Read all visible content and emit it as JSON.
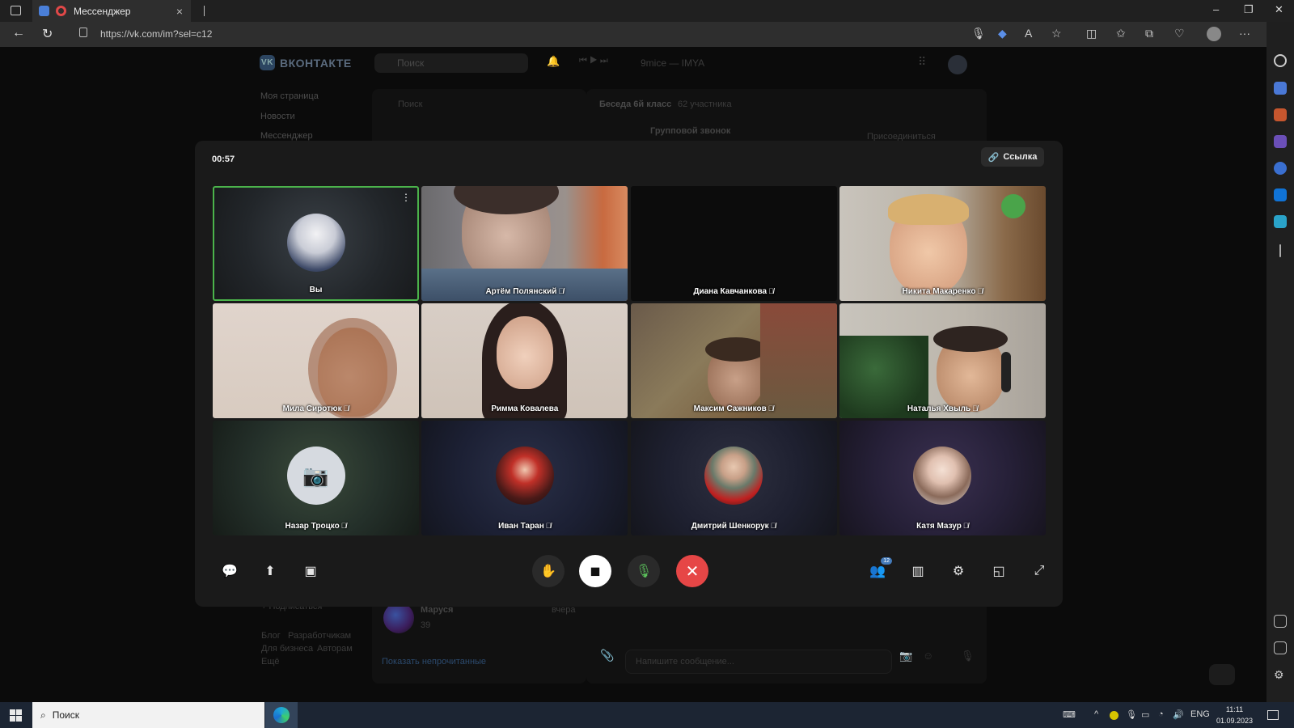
{
  "browser": {
    "tab_title": "Мессенджер",
    "url": "https://vk.com/im?sel=c12"
  },
  "vk": {
    "logo": "ВКОНТАКТЕ",
    "search_placeholder": "Поиск",
    "now_playing": "9mice — IMYA",
    "sidebar": [
      "Моя страница",
      "Новости",
      "Мессенджер"
    ],
    "list_search_placeholder": "Поиск",
    "chat_title": "Беседа 6й класс",
    "chat_members": "62 участника",
    "group_call_label": "Групповой звонок",
    "join_button": "Присоединиться",
    "subscribe": "+ Подписаться",
    "footer_links": [
      "Блог",
      "Разработчикам",
      "Для бизнеса",
      "Авторам",
      "Ещё"
    ],
    "conv_name": "Маруся",
    "conv_preview": "39",
    "conv_time": "вчера",
    "show_unread": "Показать непрочитанные",
    "message_placeholder": "Напишите сообщение..."
  },
  "call": {
    "timer": "00:57",
    "link_button": "Ссылка",
    "participants_count": "12",
    "participants": [
      {
        "name": "Вы",
        "kind": "avatar",
        "muted": false
      },
      {
        "name": "Артём Полянский",
        "kind": "video",
        "muted": true
      },
      {
        "name": "Диана Кавчанкова",
        "kind": "blank",
        "muted": true
      },
      {
        "name": "Никита Макаренко",
        "kind": "video",
        "muted": true
      },
      {
        "name": "Мила Сиротюк",
        "kind": "video",
        "muted": true
      },
      {
        "name": "Римма Ковалева",
        "kind": "video",
        "muted": false
      },
      {
        "name": "Максим Сажников",
        "kind": "video",
        "muted": true
      },
      {
        "name": "Наталья Хвыль",
        "kind": "video",
        "muted": true
      },
      {
        "name": "Назар Троцко",
        "kind": "avatar",
        "muted": true
      },
      {
        "name": "Иван Таран",
        "kind": "avatar",
        "muted": true
      },
      {
        "name": "Дмитрий Шенкорук",
        "kind": "avatar",
        "muted": true
      },
      {
        "name": "Катя Мазур",
        "kind": "avatar",
        "muted": true
      }
    ],
    "controls": {
      "left": [
        "chat-icon",
        "screen-share-icon",
        "record-icon"
      ],
      "center": [
        "raise-hand-icon",
        "camera-off-icon",
        "microphone-icon",
        "end-call-icon"
      ],
      "right": [
        "participants-icon",
        "layout-icon",
        "settings-icon",
        "pip-icon",
        "fullscreen-icon"
      ]
    }
  },
  "taskbar": {
    "search_label": "Поиск",
    "language": "ENG",
    "time": "11:11",
    "date": "01.09.2023"
  },
  "colors": {
    "accent_green": "#4bb34b",
    "end_call_red": "#e64646",
    "badge_blue": "#447bba"
  }
}
